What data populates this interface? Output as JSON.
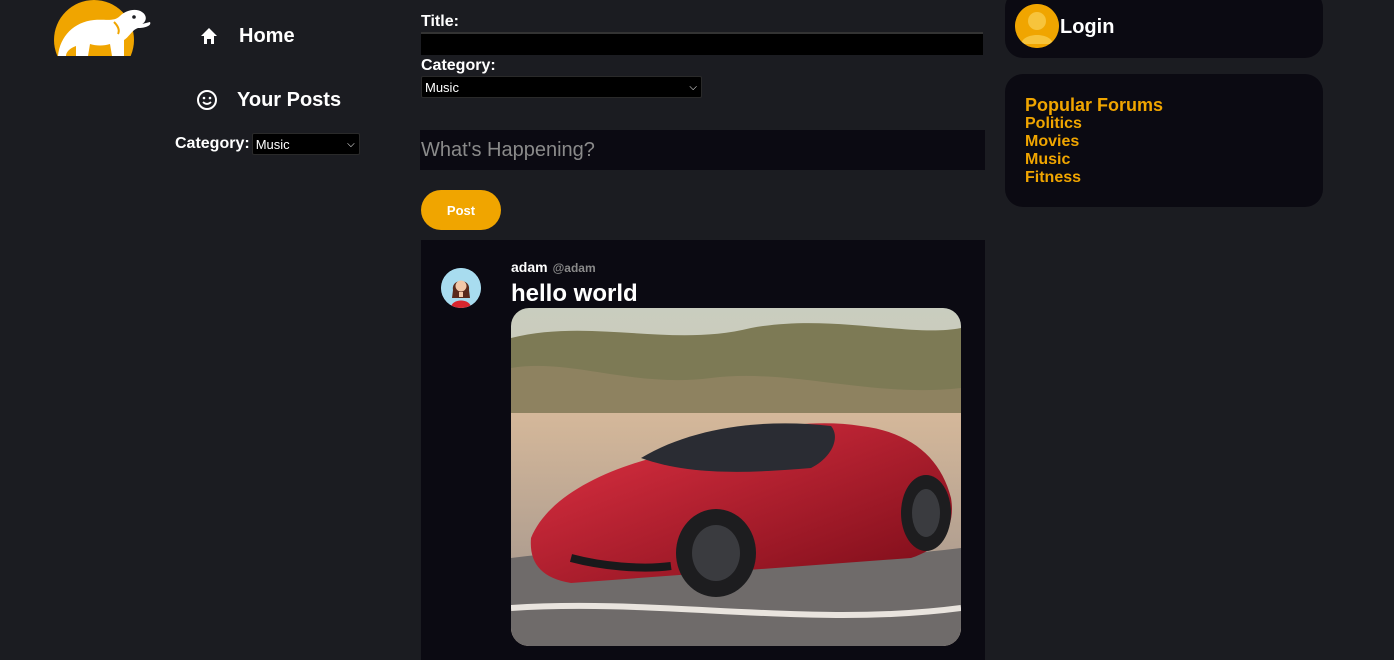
{
  "brand": {
    "logo_icon": "elephant-logo-icon",
    "accent_color": "#f0a500"
  },
  "nav": {
    "home": {
      "label": "Home",
      "icon": "home-icon"
    },
    "your_posts": {
      "label": "Your Posts",
      "icon": "smiley-icon"
    },
    "category": {
      "label": "Category:",
      "selected": "Music"
    }
  },
  "compose": {
    "title_label": "Title:",
    "title_value": "",
    "category_label": "Category:",
    "category_selected": "Music",
    "placeholder": "What's Happening?",
    "post_button": "Post"
  },
  "feed": {
    "posts": [
      {
        "username": "adam",
        "handle": "@adam",
        "title": "hello world",
        "avatar_icon": "user-avatar-icon",
        "image": "red-sports-car-photo"
      }
    ]
  },
  "account": {
    "login_label": "Login",
    "avatar_icon": "default-user-icon"
  },
  "forums": {
    "title": "Popular Forums",
    "items": [
      "Politics",
      "Movies",
      "Music",
      "Fitness"
    ]
  }
}
